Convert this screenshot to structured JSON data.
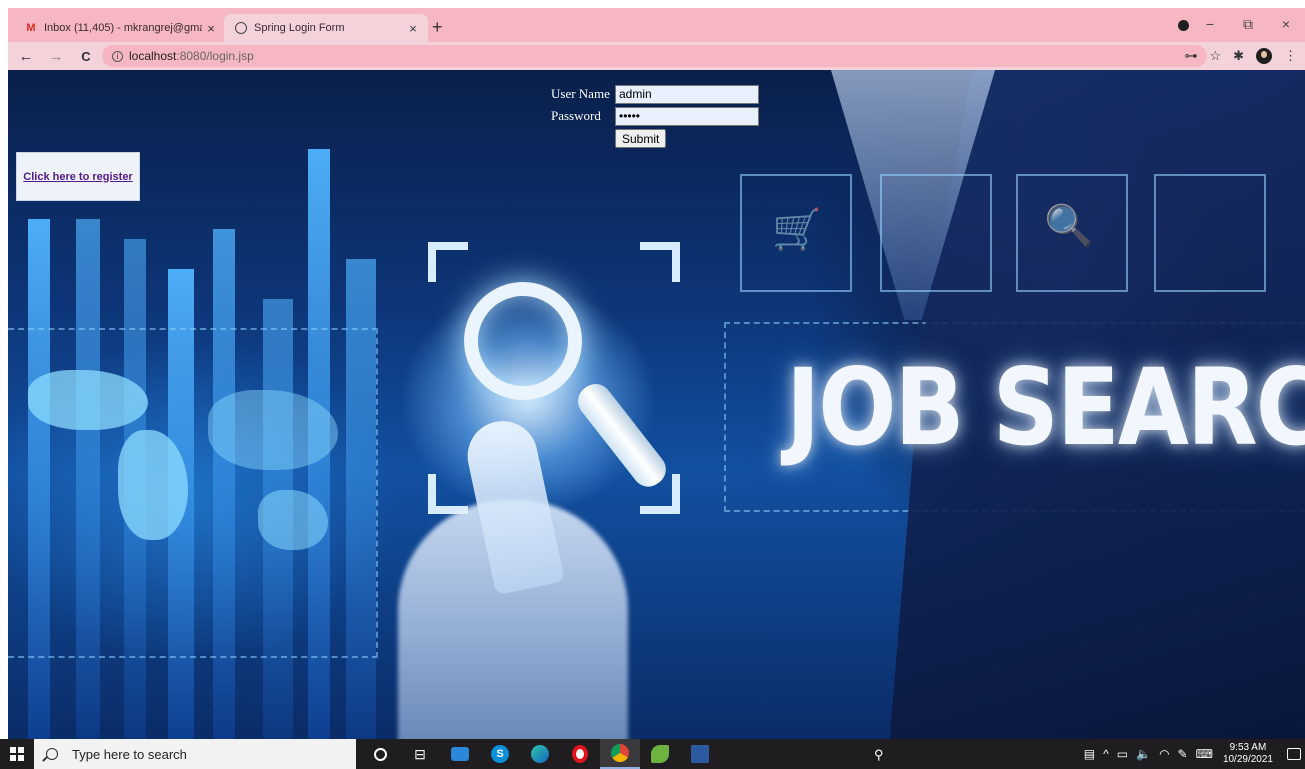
{
  "browser": {
    "tabs": [
      {
        "title": "Inbox (11,405) - mkrangrej@gma",
        "icon": "gmail-icon",
        "active": false
      },
      {
        "title": "Spring Login Form",
        "icon": "globe-icon",
        "active": true
      }
    ],
    "tab_close_glyph": "×",
    "new_tab_glyph": "+",
    "window_controls": {
      "minimize": "−",
      "restore": "⧉",
      "close": "×"
    },
    "nav": {
      "back": "←",
      "forward": "→",
      "reload": "C"
    },
    "url_host": "localhost",
    "url_path": ":8080/login.jsp",
    "toolbar_icons": {
      "key": "⊶",
      "star": "☆",
      "extensions": "✱",
      "menu": "⋮"
    }
  },
  "page": {
    "register_link": "Click here to register",
    "login_form": {
      "username_label": "User Name",
      "username_value": "admin",
      "password_label": "Password",
      "password_value": "admin",
      "submit_label": "Submit"
    },
    "background_headline": "JOB SEARCH"
  },
  "taskbar": {
    "search_placeholder": "Type here to search",
    "tray": {
      "expand": "^",
      "clock_time": "9:53 AM",
      "clock_date": "10/29/2021"
    }
  },
  "colors": {
    "chrome_bg": "#f6b6c2",
    "toolbar_bg": "#f3d3d9",
    "link_visited": "#551a8b",
    "taskbar_bg": "#1f1d20"
  }
}
